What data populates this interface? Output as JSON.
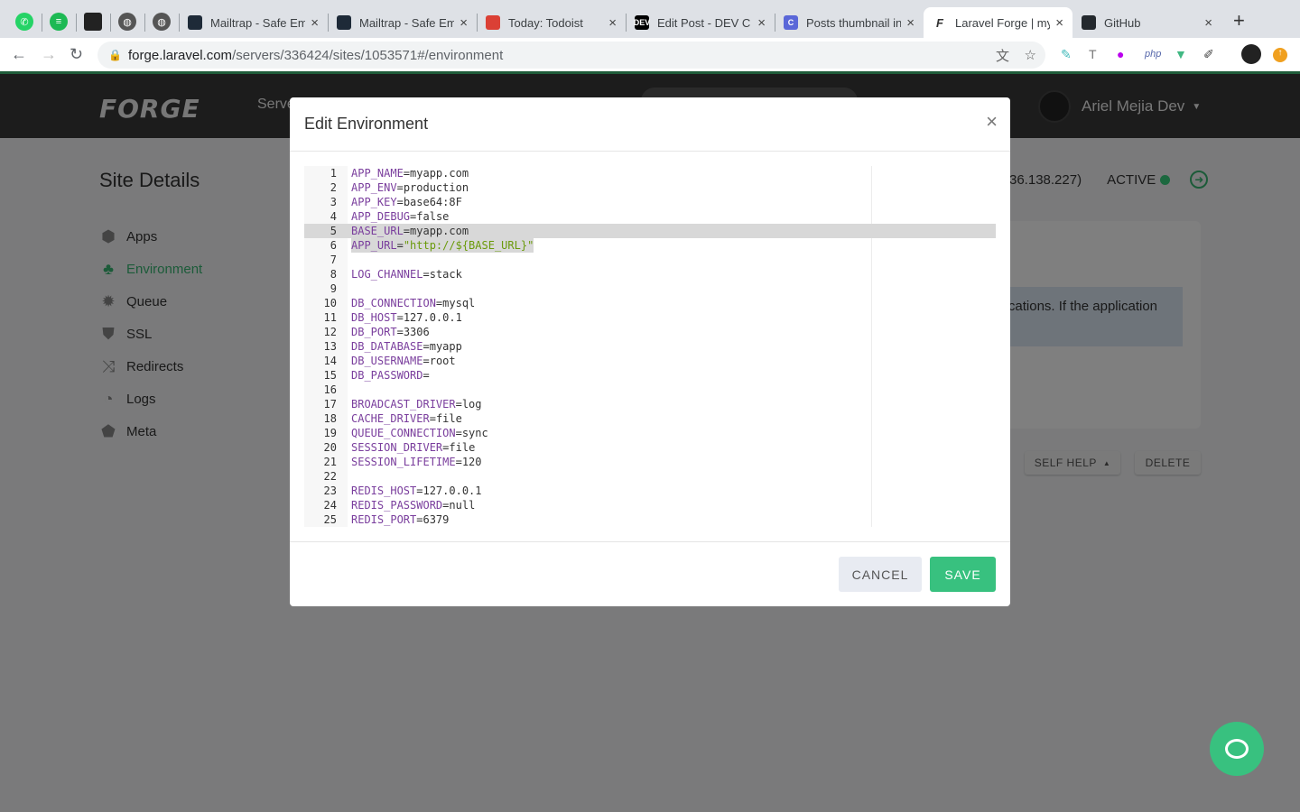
{
  "browser": {
    "pinned": [
      "whatsapp-icon",
      "spotify-icon",
      "pinned-app-icon",
      "globe-icon",
      "globe-icon"
    ],
    "tabs": [
      {
        "title": "Mailtrap - Safe Em",
        "color": "#1e2a38"
      },
      {
        "title": "Mailtrap - Safe Em",
        "color": "#1e2a38"
      },
      {
        "title": "Today: Todoist",
        "color": "#db4035"
      },
      {
        "title": "Edit Post - DEV C",
        "color": "#000000",
        "badge": "DEV"
      },
      {
        "title": "Posts thumbnail in",
        "color": "#5a67d8",
        "badge": "C"
      },
      {
        "title": "Laravel Forge | my",
        "active": true,
        "badge": "F"
      },
      {
        "title": "GitHub",
        "color": "#24292e"
      }
    ],
    "url_host": "forge.laravel.com",
    "url_path": "/servers/336424/sites/1053571#/environment",
    "extensions": [
      "translate-icon",
      "star-icon",
      "eyedropper-icon",
      "text-icon",
      "extension-icon",
      "php",
      "vue-icon",
      "pencil-icon",
      "profile-icon",
      "update-icon"
    ],
    "php_label": "php"
  },
  "header": {
    "logo": "FORGE",
    "nav": "Servers",
    "user": "Ariel Mejia Dev"
  },
  "sidebar": {
    "title": "Site Details",
    "items": [
      {
        "label": "Apps",
        "icon": "cube-icon"
      },
      {
        "label": "Environment",
        "icon": "tree-icon",
        "active": true
      },
      {
        "label": "Queue",
        "icon": "gear-icon"
      },
      {
        "label": "SSL",
        "icon": "shield-icon"
      },
      {
        "label": "Redirects",
        "icon": "shuffle-icon"
      },
      {
        "label": "Logs",
        "icon": "logs-icon"
      },
      {
        "label": "Meta",
        "icon": "tag-icon"
      }
    ]
  },
  "site": {
    "ip_fragment": "36.138.227)",
    "status": "ACTIVE",
    "alert_fragment": "ications. If the application",
    "self_help": "SELF HELP",
    "delete": "DELETE"
  },
  "modal": {
    "title": "Edit Environment",
    "close": "×",
    "cancel": "CANCEL",
    "save": "SAVE",
    "lines": [
      [
        "APP_NAME",
        "myapp.com"
      ],
      [
        "APP_ENV",
        "production"
      ],
      [
        "APP_KEY",
        "base64:8F"
      ],
      [
        "APP_DEBUG",
        "false"
      ],
      [
        "BASE_URL",
        "myapp.com"
      ],
      [
        "APP_URL",
        "\"http://${BASE_URL}\""
      ],
      [
        "",
        ""
      ],
      [
        "LOG_CHANNEL",
        "stack"
      ],
      [
        "",
        ""
      ],
      [
        "DB_CONNECTION",
        "mysql"
      ],
      [
        "DB_HOST",
        "127.0.0.1"
      ],
      [
        "DB_PORT",
        "3306"
      ],
      [
        "DB_DATABASE",
        "myapp"
      ],
      [
        "DB_USERNAME",
        "root"
      ],
      [
        "DB_PASSWORD",
        ""
      ],
      [
        "",
        ""
      ],
      [
        "BROADCAST_DRIVER",
        "log"
      ],
      [
        "CACHE_DRIVER",
        "file"
      ],
      [
        "QUEUE_CONNECTION",
        "sync"
      ],
      [
        "SESSION_DRIVER",
        "file"
      ],
      [
        "SESSION_LIFETIME",
        "120"
      ],
      [
        "",
        ""
      ],
      [
        "REDIS_HOST",
        "127.0.0.1"
      ],
      [
        "REDIS_PASSWORD",
        "null"
      ],
      [
        "REDIS_PORT",
        "6379"
      ]
    ]
  }
}
